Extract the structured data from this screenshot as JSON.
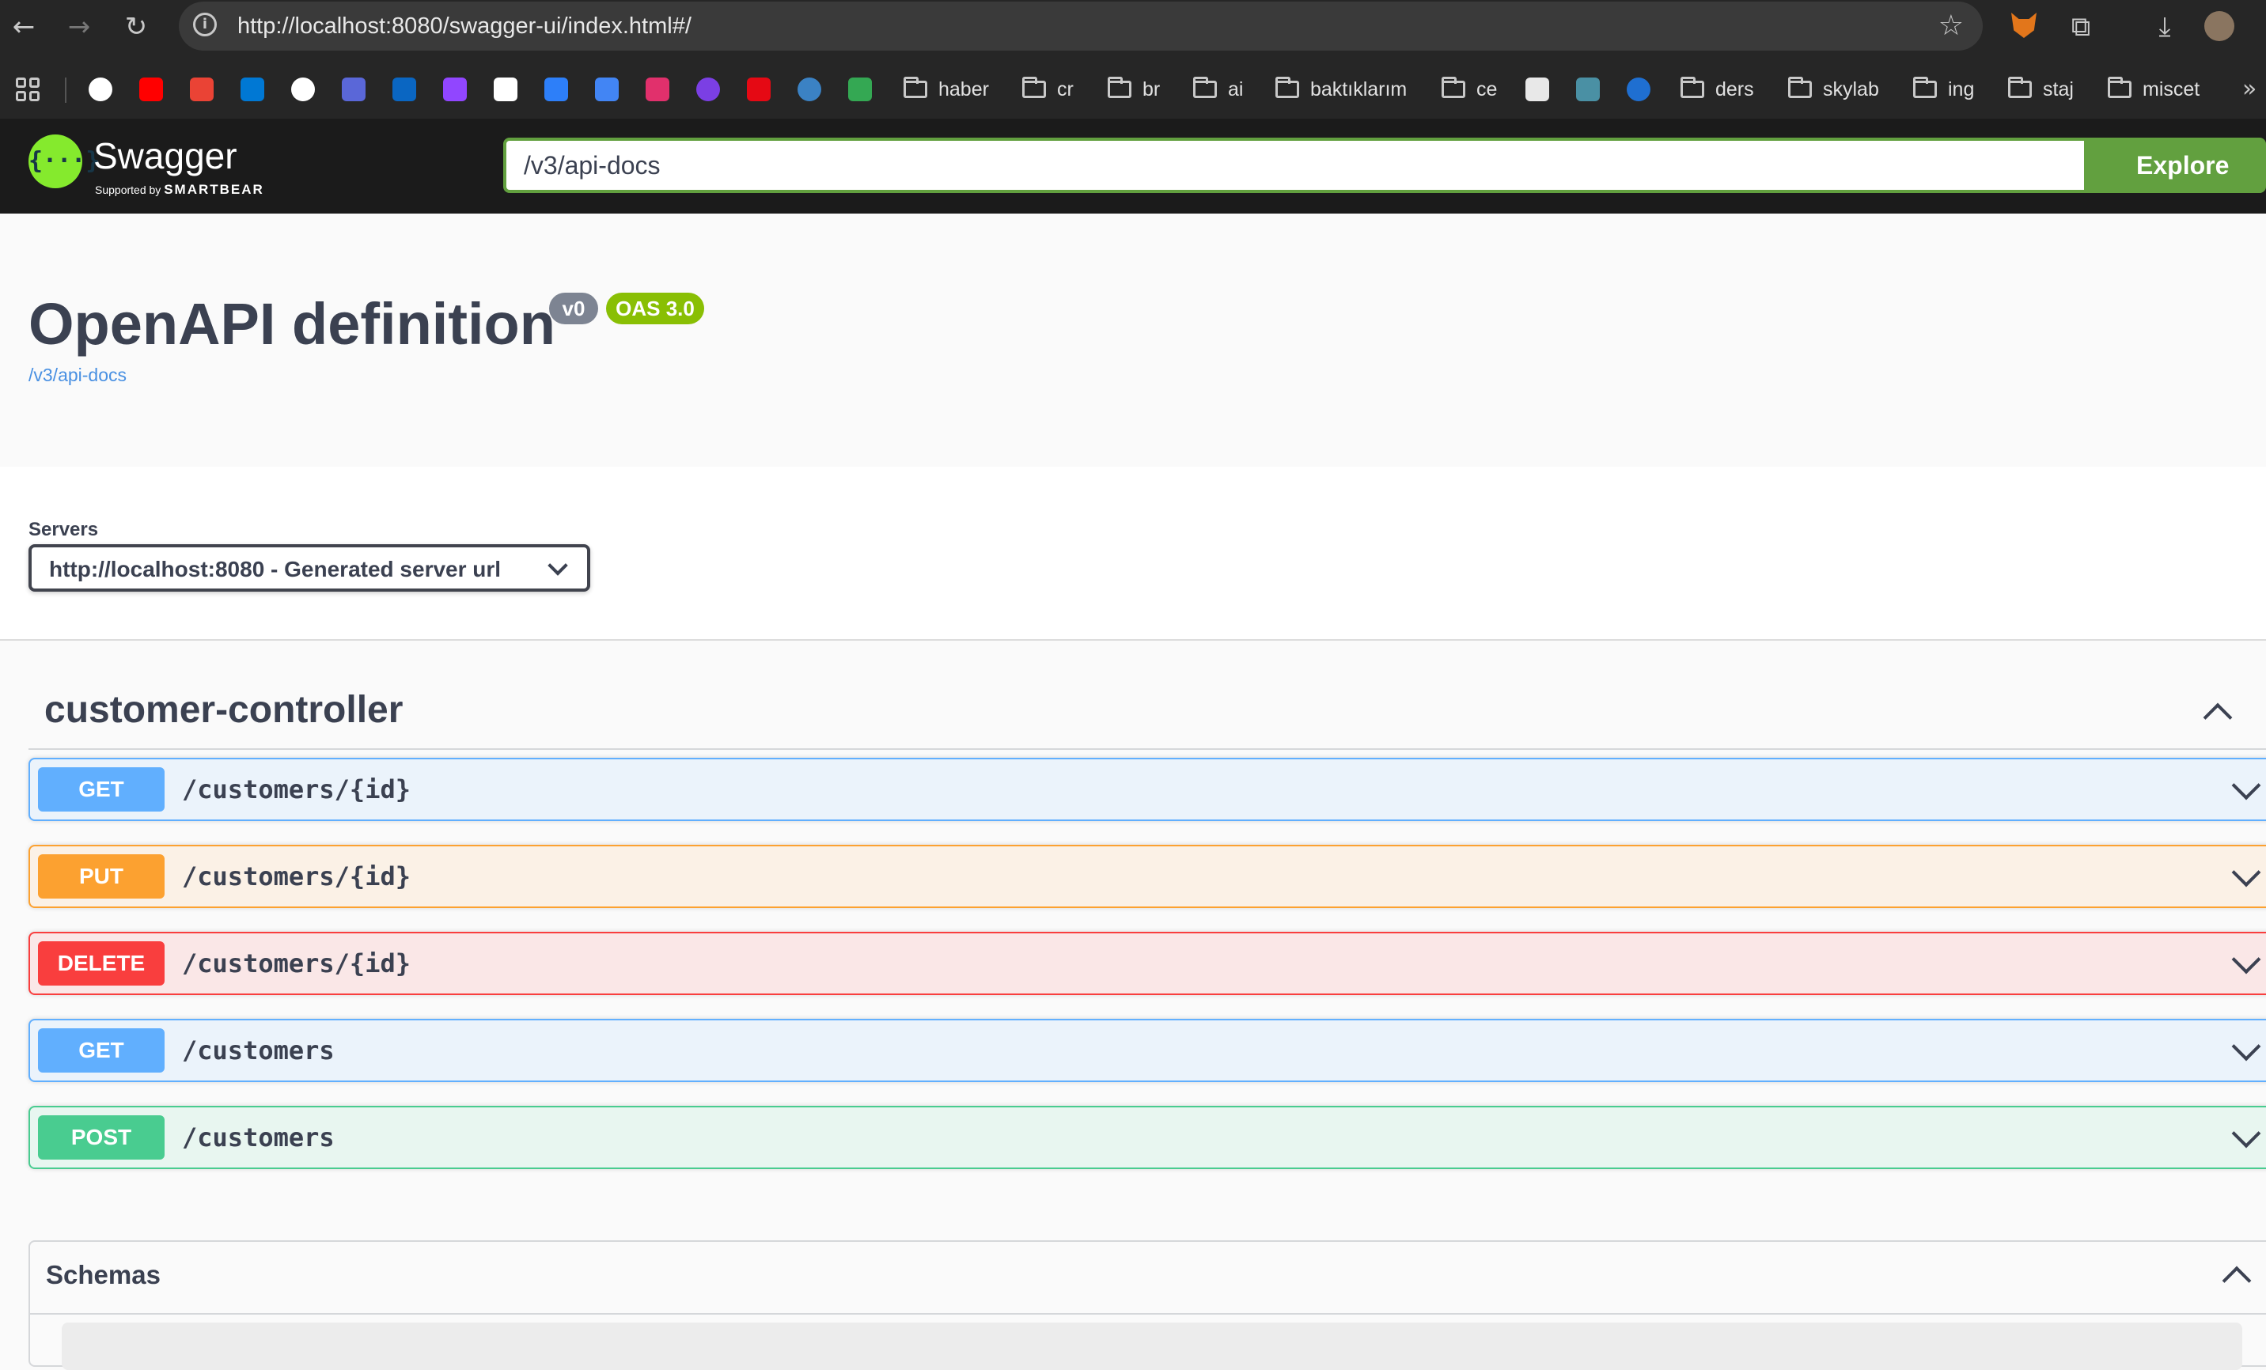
{
  "browser": {
    "url": "http://localhost:8080/swagger-ui/index.html#/",
    "bookmark_folders": [
      "haber",
      "cr",
      "br",
      "ai",
      "baktıklarım",
      "ce",
      "ders",
      "skylab",
      "ing",
      "staj",
      "miscet"
    ]
  },
  "swagger": {
    "logo_name": "Swagger",
    "logo_sub_prefix": "Supported by",
    "logo_sub_brand": "SMARTBEAR",
    "url_value": "/v3/api-docs",
    "explore_label": "Explore"
  },
  "info": {
    "title": "OpenAPI definition",
    "version": "v0",
    "oas": "OAS 3.0",
    "spec_link": "/v3/api-docs"
  },
  "servers": {
    "label": "Servers",
    "selected": "http://localhost:8080 - Generated server url"
  },
  "tag": {
    "name": "customer-controller",
    "operations": [
      {
        "method": "GET",
        "path": "/customers/{id}"
      },
      {
        "method": "PUT",
        "path": "/customers/{id}"
      },
      {
        "method": "DELETE",
        "path": "/customers/{id}"
      },
      {
        "method": "GET",
        "path": "/customers"
      },
      {
        "method": "POST",
        "path": "/customers"
      }
    ]
  },
  "schemas": {
    "title": "Schemas"
  },
  "colors": {
    "get": "#61affe",
    "put": "#fca130",
    "delete": "#f93e3e",
    "post": "#49cc90",
    "accent": "#62a03f",
    "logo": "#85ea2d"
  }
}
